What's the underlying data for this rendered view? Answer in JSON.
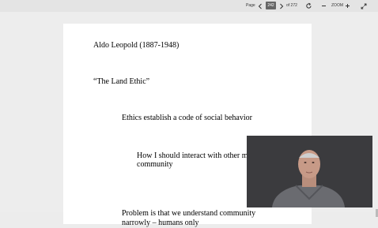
{
  "toolbar": {
    "page_label": "Page",
    "current_page": "242",
    "total_pages": "of 272",
    "zoom_label": "ZOOM"
  },
  "document": {
    "author_line": "Aldo Leopold (1887-1948)",
    "title_line": "“The Land Ethic”",
    "point1": "Ethics establish a code of social behavior",
    "point2_line1": "How I should interact with other mem",
    "point2_line2": "community",
    "point3_line1": "Problem is that we understand community",
    "point3_line2": "narrowly – humans only"
  },
  "colors": {
    "toolbar_bg": "#e4e4e4",
    "page_bg": "#ffffff",
    "video_bg": "#3b3b3e"
  }
}
